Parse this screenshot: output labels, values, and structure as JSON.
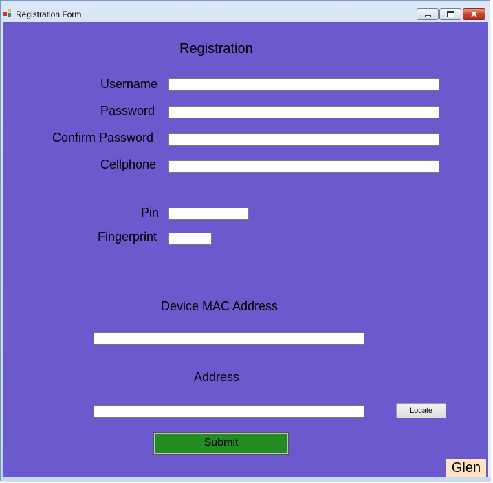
{
  "window": {
    "title": "Registration Form",
    "controls": {
      "minimize": "minimize",
      "maximize": "maximize",
      "close": "✕"
    }
  },
  "form": {
    "heading": "Registration",
    "fields": {
      "username": {
        "label": "Username",
        "value": ""
      },
      "password": {
        "label": "Password",
        "value": ""
      },
      "confirm_password": {
        "label": "Confirm Password",
        "value": ""
      },
      "cellphone": {
        "label": "Cellphone",
        "value": ""
      },
      "pin": {
        "label": "Pin",
        "value": ""
      },
      "fingerprint": {
        "label": "Fingerprint",
        "value": ""
      }
    },
    "mac_section": {
      "label": "Device MAC Address",
      "value": ""
    },
    "address_section": {
      "label": "Address",
      "value": ""
    },
    "locate_label": "Locate",
    "submit_label": "Submit",
    "footer_tag": "Glen"
  },
  "colors": {
    "client_background": "#6a5acd",
    "submit_background": "#228b22",
    "tag_background": "#ffe4c4"
  }
}
